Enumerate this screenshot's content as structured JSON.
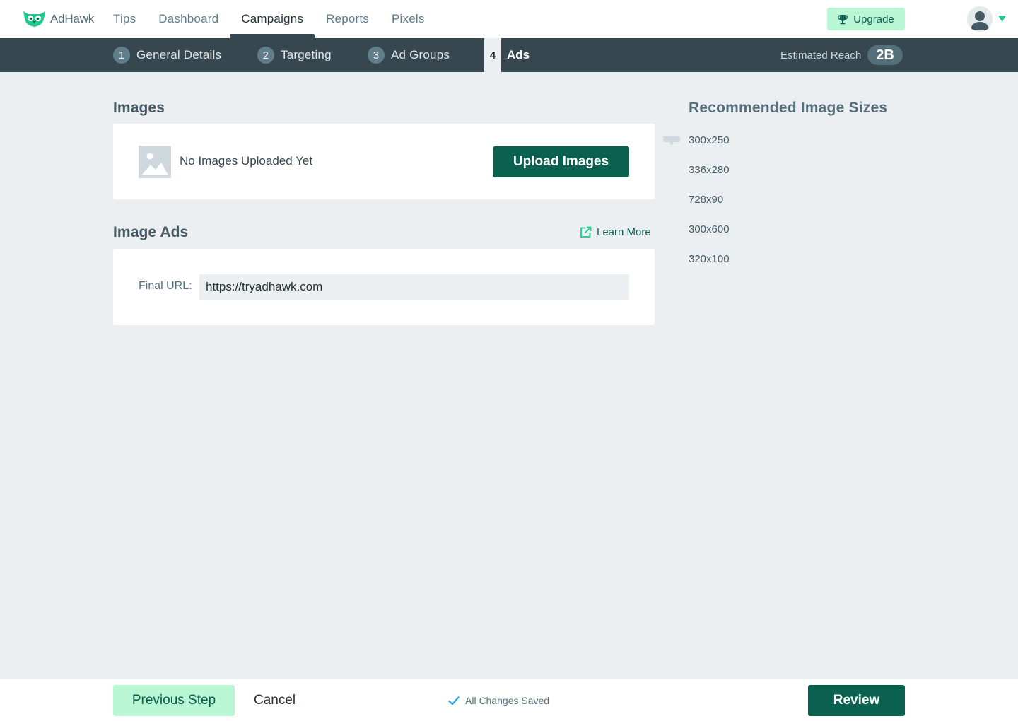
{
  "app": {
    "name": "AdHawk",
    "logo_icon": "owl-icon"
  },
  "topnav": {
    "items": [
      {
        "label": "Tips"
      },
      {
        "label": "Dashboard"
      },
      {
        "label": "Campaigns",
        "active": true
      },
      {
        "label": "Reports"
      },
      {
        "label": "Pixels"
      }
    ],
    "upgrade_label": "Upgrade",
    "upgrade_icon": "trophy-icon",
    "avatar_icon": "user-avatar-icon",
    "menu_caret_icon": "caret-down-icon"
  },
  "steps": {
    "items": [
      {
        "num": "1",
        "label": "General Details"
      },
      {
        "num": "2",
        "label": "Targeting"
      },
      {
        "num": "3",
        "label": "Ad Groups"
      },
      {
        "num": "4",
        "label": "Ads",
        "active": true
      }
    ],
    "reach_label": "Estimated Reach",
    "reach_value": "2B"
  },
  "images_section": {
    "title": "Images",
    "empty_text": "No Images Uploaded Yet",
    "upload_label": "Upload Images",
    "placeholder_icon": "image-placeholder-icon"
  },
  "image_ads_section": {
    "title": "Image Ads",
    "learn_more_label": "Learn More",
    "learn_more_icon": "external-link-icon",
    "final_url_label": "Final URL:",
    "final_url_value": "https://tryadhawk.com"
  },
  "recommended_sizes": {
    "title": "Recommended Image Sizes",
    "sizes": [
      "300x250",
      "336x280",
      "728x90",
      "300x600",
      "320x100"
    ]
  },
  "footer": {
    "previous_label": "Previous Step",
    "cancel_label": "Cancel",
    "saved_label": "All Changes Saved",
    "saved_icon": "checkmark-icon",
    "review_label": "Review"
  },
  "colors": {
    "brand_green": "#1ec98a",
    "dark_teal": "#0b6150",
    "light_mint": "#b9f6d3",
    "slate": "#37474f",
    "background": "#eceff1"
  }
}
